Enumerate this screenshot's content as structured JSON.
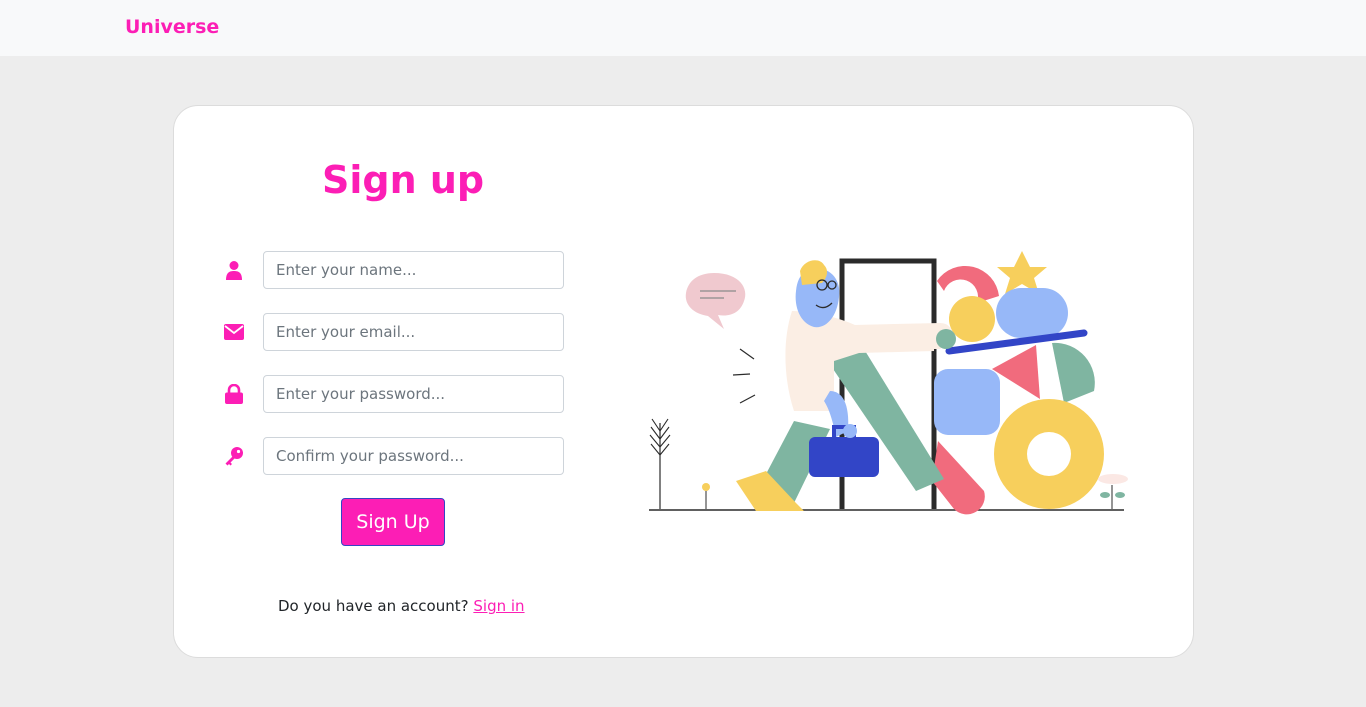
{
  "navbar": {
    "brand": "Universe"
  },
  "form": {
    "title": "Sign up",
    "fields": [
      {
        "name": "name",
        "placeholder": "Enter your name...",
        "value": "",
        "icon": "user-icon"
      },
      {
        "name": "email",
        "placeholder": "Enter your email...",
        "value": "",
        "icon": "envelope-icon"
      },
      {
        "name": "password",
        "placeholder": "Enter your password...",
        "value": "",
        "icon": "lock-icon"
      },
      {
        "name": "confirm",
        "placeholder": "Confirm your password...",
        "value": "",
        "icon": "key-icon"
      }
    ],
    "submit_label": "Sign Up",
    "account_prompt": "Do you have an account?",
    "signin_label": "Sign in"
  },
  "colors": {
    "accent": "#fc1eb5",
    "page_bg": "#ededed",
    "navbar_bg": "#f8f9fa",
    "card_bg": "#ffffff"
  }
}
